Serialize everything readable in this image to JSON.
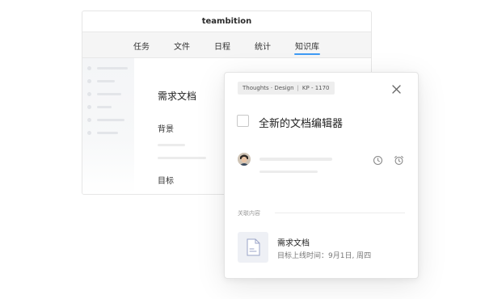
{
  "app": {
    "title": "teambition",
    "tabs": [
      {
        "label": "任务"
      },
      {
        "label": "文件"
      },
      {
        "label": "日程"
      },
      {
        "label": "统计"
      },
      {
        "label": "知识库"
      }
    ],
    "active_tab": "知识库",
    "document": {
      "title": "需求文档",
      "section_background": "背景",
      "section_goal": "目标"
    }
  },
  "card": {
    "tag_left": "Thoughts · Design",
    "tag_right": "KP - 1170",
    "task_title": "全新的文档编辑器",
    "related_label": "关联内容",
    "related_item": {
      "title": "需求文档",
      "subtitle": "目标上线时间：9月1日, 周四"
    }
  },
  "colors": {
    "accent": "#3f9bf5",
    "placeholder_line": "#ececec",
    "doc_icon_bg": "#eef0f5"
  },
  "icons": [
    "close-icon",
    "history-icon",
    "alarm-clock-icon",
    "document-icon",
    "avatar"
  ]
}
